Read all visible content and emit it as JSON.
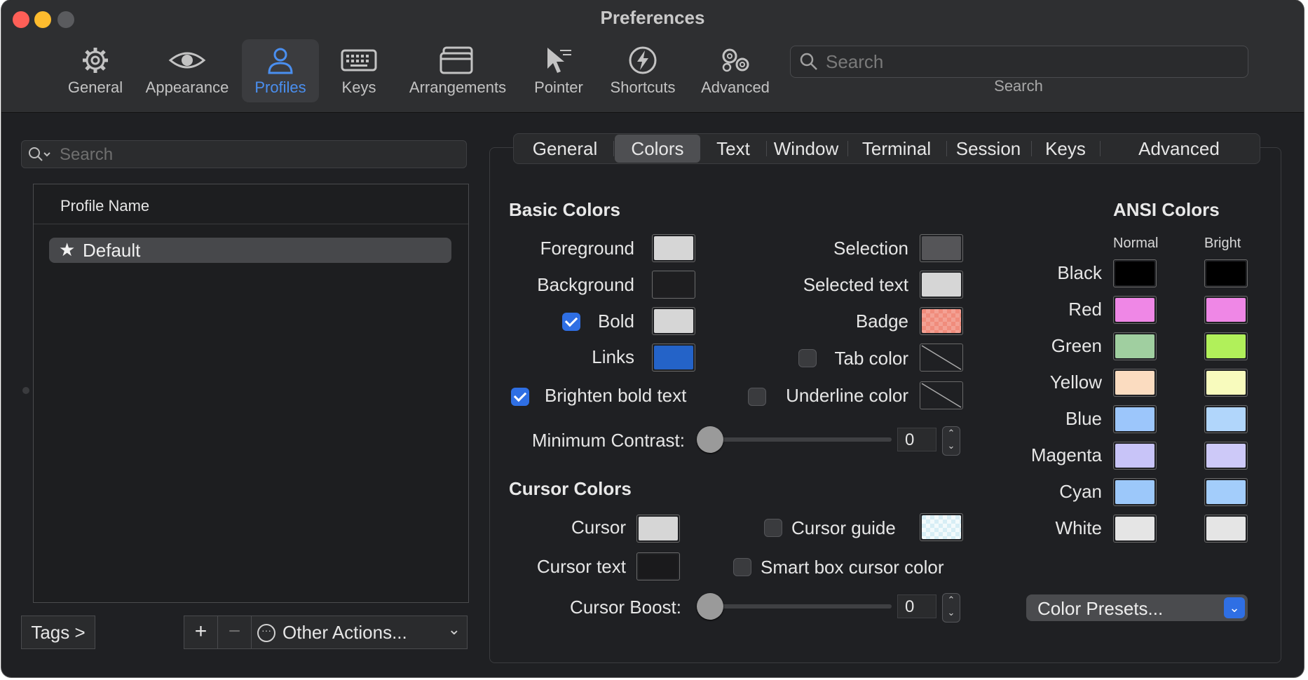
{
  "window": {
    "title": "Preferences"
  },
  "toolbar": {
    "items": [
      {
        "label": "General",
        "icon": "gear-icon"
      },
      {
        "label": "Appearance",
        "icon": "eye-icon"
      },
      {
        "label": "Profiles",
        "icon": "person-icon",
        "selected": true
      },
      {
        "label": "Keys",
        "icon": "keyboard-icon"
      },
      {
        "label": "Arrangements",
        "icon": "windows-icon"
      },
      {
        "label": "Pointer",
        "icon": "pointer-icon"
      },
      {
        "label": "Shortcuts",
        "icon": "lightning-icon"
      },
      {
        "label": "Advanced",
        "icon": "gears-icon"
      }
    ],
    "search_placeholder": "Search",
    "search_caption": "Search"
  },
  "profiles": {
    "search_placeholder": "Search",
    "column_header": "Profile Name",
    "rows": [
      {
        "name": "Default",
        "icon": "star-icon"
      }
    ],
    "tags_button": "Tags >",
    "add": "+",
    "remove": "−",
    "other_actions": "Other Actions...",
    "other_actions_icon": "ellipsis-circle-icon"
  },
  "tabs": [
    "General",
    "Colors",
    "Text",
    "Window",
    "Terminal",
    "Session",
    "Keys",
    "Advanced"
  ],
  "selected_tab": "Colors",
  "basic_colors": {
    "title": "Basic Colors",
    "foreground": {
      "label": "Foreground",
      "color": "#d6d6d6"
    },
    "background": {
      "label": "Background",
      "color": "#1e1e20"
    },
    "bold": {
      "label": "Bold",
      "checked": true,
      "color": "#d6d6d6"
    },
    "links": {
      "label": "Links",
      "color": "#2463c8"
    },
    "brighten_bold": {
      "label": "Brighten bold text",
      "checked": true
    },
    "selection": {
      "label": "Selection",
      "color": "#555558"
    },
    "selected_text": {
      "label": "Selected text",
      "color": "#d6d6d6"
    },
    "badge": {
      "label": "Badge",
      "color": "#f08c7c"
    },
    "tab_color": {
      "label": "Tab color",
      "checked": false
    },
    "underline_color": {
      "label": "Underline color",
      "checked": false
    },
    "min_contrast": {
      "label": "Minimum Contrast:",
      "value": "0"
    }
  },
  "cursor_colors": {
    "title": "Cursor Colors",
    "cursor": {
      "label": "Cursor",
      "color": "#d6d6d6"
    },
    "cursor_text": {
      "label": "Cursor text",
      "color": "#1a1a1c"
    },
    "cursor_guide": {
      "label": "Cursor guide",
      "checked": false,
      "color": "#d7eef5"
    },
    "smart_box": {
      "label": "Smart box cursor color",
      "checked": false
    },
    "boost": {
      "label": "Cursor Boost:",
      "value": "0"
    }
  },
  "ansi": {
    "title": "ANSI Colors",
    "normal_label": "Normal",
    "bright_label": "Bright",
    "rows": [
      {
        "name": "Black",
        "normal": "#000000",
        "bright": "#000000"
      },
      {
        "name": "Red",
        "normal": "#ef87e6",
        "bright": "#ef87e6"
      },
      {
        "name": "Green",
        "normal": "#a0cfa0",
        "bright": "#b1f05a"
      },
      {
        "name": "Yellow",
        "normal": "#fbdcc0",
        "bright": "#f8fbbd"
      },
      {
        "name": "Blue",
        "normal": "#9cc6fb",
        "bright": "#b1d6fb"
      },
      {
        "name": "Magenta",
        "normal": "#c8c4f8",
        "bright": "#cdc9f8"
      },
      {
        "name": "Cyan",
        "normal": "#9cc8fa",
        "bright": "#a3cdfb"
      },
      {
        "name": "White",
        "normal": "#e5e5e5",
        "bright": "#e5e5e5"
      }
    ],
    "presets_label": "Color Presets..."
  }
}
